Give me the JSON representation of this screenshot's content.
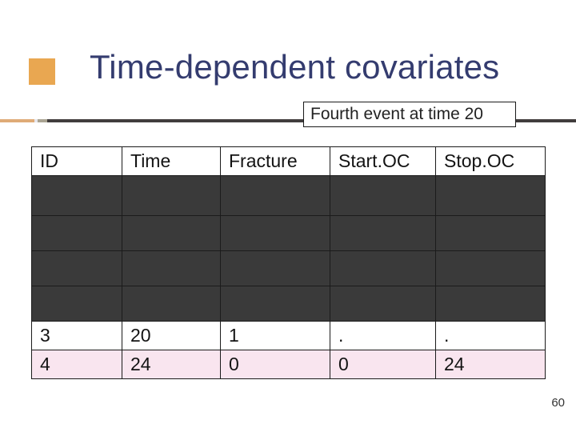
{
  "title": "Time-dependent covariates",
  "subtitle": "Fourth event at time 20",
  "table": {
    "headers": {
      "id": "ID",
      "time": "Time",
      "fracture": "Fracture",
      "startoc": "Start.OC",
      "stopoc": "Stop.OC"
    },
    "rows": [
      {
        "id": "3",
        "time": "20",
        "fracture": "1",
        "startoc": ".",
        "stopoc": "."
      },
      {
        "id": "4",
        "time": "24",
        "fracture": "0",
        "startoc": "0",
        "stopoc": "24"
      }
    ]
  },
  "page_number": "60",
  "chart_data": {
    "type": "table",
    "title": "Time-dependent covariates — Fourth event at time 20",
    "columns": [
      "ID",
      "Time",
      "Fracture",
      "Start.OC",
      "Stop.OC"
    ],
    "rows_visible": [
      [
        "3",
        "20",
        "1",
        ".",
        "."
      ],
      [
        "4",
        "24",
        "0",
        "0",
        "24"
      ]
    ],
    "rows_hidden_count": 4,
    "highlighted_row_index": 1
  }
}
